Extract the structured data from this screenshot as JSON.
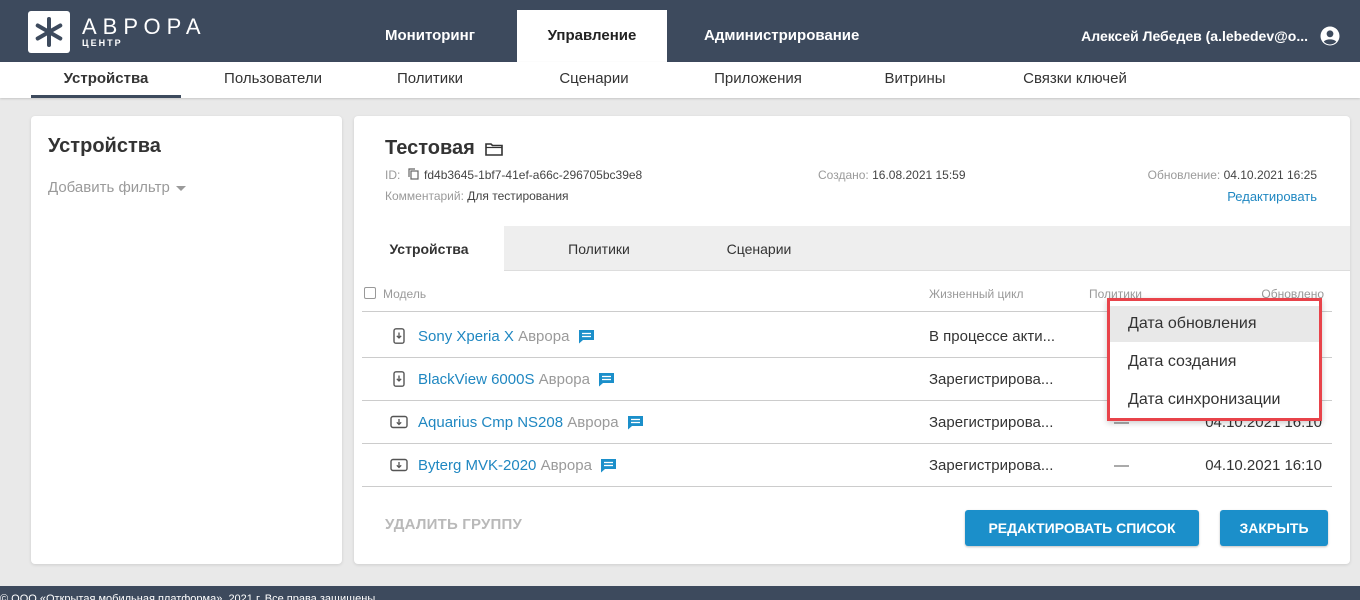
{
  "app": {
    "logo_name": "АВРОРА",
    "logo_sub": "ЦЕНТР"
  },
  "header": {
    "tabs": [
      {
        "label": "Мониторинг",
        "active": false
      },
      {
        "label": "Управление",
        "active": true
      },
      {
        "label": "Администрирование",
        "active": false
      }
    ],
    "user": "Алексей Лебедев (a.lebedev@o..."
  },
  "subnav": {
    "items": [
      {
        "label": "Устройства",
        "active": true
      },
      {
        "label": "Пользователи",
        "active": false
      },
      {
        "label": "Политики",
        "active": false
      },
      {
        "label": "Сценарии",
        "active": false
      },
      {
        "label": "Приложения",
        "active": false
      },
      {
        "label": "Витрины",
        "active": false
      },
      {
        "label": "Связки ключей",
        "active": false
      }
    ]
  },
  "left_panel": {
    "title": "Устройства",
    "add_filter": "Добавить фильтр"
  },
  "group": {
    "title": "Тестовая",
    "id_label": "ID:",
    "id_value": "fd4b3645-1bf7-41ef-a66c-296705bc39e8",
    "comment_label": "Комментарий:",
    "comment_value": "Для тестирования",
    "created_label": "Создано:",
    "created_value": "16.08.2021 15:59",
    "updated_label": "Обновление:",
    "updated_value": "04.10.2021 16:25",
    "edit_link": "Редактировать"
  },
  "inner_tabs": [
    {
      "label": "Устройства",
      "active": true
    },
    {
      "label": "Политики",
      "active": false
    },
    {
      "label": "Сценарии",
      "active": false
    }
  ],
  "table": {
    "columns": {
      "model": "Модель",
      "lifecycle": "Жизненный цикл",
      "policies": "Политики",
      "updated": "Обновлено"
    },
    "rows": [
      {
        "model": "Sony Xperia X",
        "os": "Аврора",
        "lifecycle": "В процессе акти...",
        "policies": "",
        "updated": "",
        "device": "phone"
      },
      {
        "model": "BlackView 6000S",
        "os": "Аврора",
        "lifecycle": "Зарегистрирова...",
        "policies": "",
        "updated": "",
        "device": "phone"
      },
      {
        "model": "Aquarius Cmp NS208",
        "os": "Аврора",
        "lifecycle": "Зарегистрирова...",
        "policies": "—",
        "updated": "04.10.2021 16:10",
        "device": "tablet"
      },
      {
        "model": "Byterg MVK-2020",
        "os": "Аврора",
        "lifecycle": "Зарегистрирова...",
        "policies": "—",
        "updated": "04.10.2021 16:10",
        "device": "tablet"
      }
    ]
  },
  "actions": {
    "delete_group": "УДАЛИТЬ ГРУППУ",
    "edit_list": "РЕДАКТИРОВАТЬ СПИСОК",
    "close": "ЗАКРЫТЬ"
  },
  "sort_dropdown": {
    "options": [
      "Дата обновления",
      "Дата создания",
      "Дата синхронизации"
    ],
    "highlight_color": "#e8434a"
  },
  "footer": {
    "text": "© ООО «Открытая мобильная платформа», 2021 г. Все права защищены"
  },
  "colors": {
    "header_bg": "#3d4a5d",
    "accent": "#1b8fca",
    "link": "#1f87c1"
  }
}
